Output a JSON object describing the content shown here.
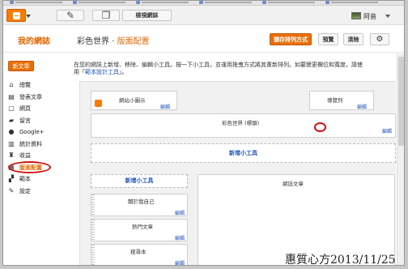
{
  "topbar": {
    "view_blog_label": "檢視網誌",
    "edit_glyph": "✎",
    "pages_glyph": "❐",
    "user_name": "阿音"
  },
  "header": {
    "brand": "我的網誌",
    "blog_name": "彩色世界",
    "separator": "·",
    "section": "版面配置",
    "save_label": "儲存排列方式",
    "preview_label": "預覽",
    "clear_label": "清除",
    "settings_glyph": "⚙"
  },
  "sidebar": {
    "new_post_label": "新文章",
    "items": [
      {
        "label": "總覽",
        "icon": "home-icon",
        "glyph": "⌂"
      },
      {
        "label": "發表文章",
        "icon": "posts-icon",
        "glyph": "▤"
      },
      {
        "label": "網頁",
        "icon": "pages-icon",
        "glyph": "▢"
      },
      {
        "label": "留言",
        "icon": "comments-icon",
        "glyph": "▰"
      },
      {
        "label": "Google+",
        "icon": "google-plus-icon",
        "glyph": "●"
      },
      {
        "label": "統計資料",
        "icon": "stats-icon",
        "glyph": "▥"
      },
      {
        "label": "收益",
        "icon": "earnings-icon",
        "glyph": "♜"
      },
      {
        "label": "版面配置",
        "icon": "layout-icon",
        "glyph": "▦"
      },
      {
        "label": "範本",
        "icon": "template-icon",
        "glyph": "▞"
      },
      {
        "label": "設定",
        "icon": "settings-wrench-icon",
        "glyph": "✎"
      }
    ]
  },
  "main": {
    "description": "在您的網誌上新增、移除、編輯小工具。按一下小工具，並運用拖曳方式將其重新排列。如要變更欄位和寬度，請使用「",
    "description_link": "範本設計工具",
    "description_end": "」。",
    "gadgets": {
      "favicon_title": "網站小圖示",
      "navbar_title": "導覽列",
      "header_title": "彩色世界 (標頭)",
      "add_gadget": "新增小工具",
      "blog_posts": "網誌文章",
      "about_me": "關於我自己",
      "popular_posts": "熱門文章",
      "search": "搜尋本",
      "edit": "編輯"
    }
  },
  "watermark": "惠質心方2013/11/25"
}
